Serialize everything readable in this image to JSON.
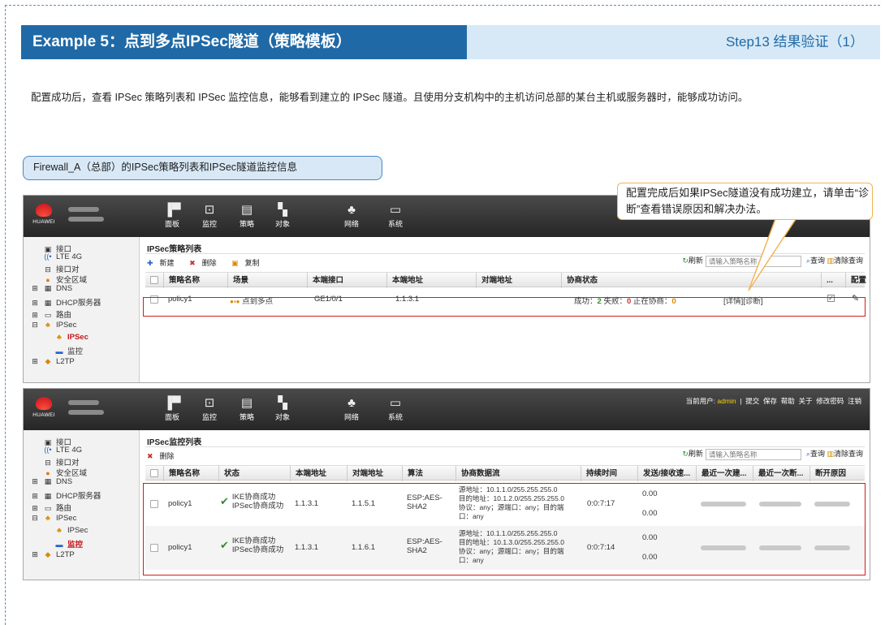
{
  "title": "Example 5：点到多点IPSec隧道（策略模板）",
  "step": "Step13 结果验证（1）",
  "description": "配置成功后，查看 IPSec 策略列表和 IPSec 监控信息，能够看到建立的 IPSec 隧道。且使用分支机构中的主机访问总部的某台主机或服务器时，能够成功访问。",
  "caption": "Firewall_A（总部）的IPSec策略列表和IPSec隧道监控信息",
  "callout": "配置完成后如果IPSec隧道没有成功建立，请单击“诊断”查看错误原因和解决办法。",
  "logo_text": "HUAWEI",
  "nav": [
    {
      "label": "面板",
      "icon": "dashboard-icon"
    },
    {
      "label": "监控",
      "icon": "monitor-icon"
    },
    {
      "label": "策略",
      "icon": "policy-icon"
    },
    {
      "label": "对象",
      "icon": "object-icon"
    },
    {
      "label": "网络",
      "icon": "network-icon"
    },
    {
      "label": "系统",
      "icon": "system-icon"
    }
  ],
  "userbar": {
    "prefix": "当前用户:",
    "user": "admin",
    "links": [
      "提交",
      "保存",
      "帮助",
      "关于",
      "修改密码",
      "注销"
    ]
  },
  "sidebar": {
    "items": [
      "接口",
      "LTE 4G",
      "接口对",
      "安全区域",
      "DNS",
      "DHCP服务器",
      "路由",
      "IPSec",
      "IPSec",
      "监控",
      "L2TP"
    ]
  },
  "screen1": {
    "title": "IPSec策略列表",
    "toolbar": {
      "new": "新建",
      "delete": "删除",
      "copy": "复制"
    },
    "refresh": "刷新",
    "search_placeholder": "请输入策略名称",
    "query": "查询",
    "clear": "清除查询",
    "columns": [
      "策略名称",
      "场景",
      "本端接口",
      "本端地址",
      "对端地址",
      "协商状态",
      "...",
      "配置"
    ],
    "row": {
      "name": "policy1",
      "scene": "点到多点",
      "iface": "GE1/0/1",
      "local": "1.1.3.1",
      "peer": "",
      "success_label": "成功：",
      "success": "2",
      "fail_label": "失败：",
      "fail": "0",
      "nego_label": "正在协商：",
      "nego": "0",
      "detail": "[详情]",
      "diag": "[诊断]"
    }
  },
  "screen2": {
    "title": "IPSec监控列表",
    "toolbar": {
      "delete": "删除"
    },
    "refresh": "刷新",
    "search_placeholder": "请输入策略名称",
    "query": "查询",
    "clear": "清除查询",
    "columns": [
      "策略名称",
      "状态",
      "本端地址",
      "对端地址",
      "算法",
      "协商数据流",
      "持续时间",
      "发送/接收速...",
      "最近一次建...",
      "最近一次断...",
      "断开原因"
    ],
    "rows": [
      {
        "name": "policy1",
        "status1": "IKE协商成功",
        "status2": "IPSec协商成功",
        "local": "1.1.3.1",
        "peer": "1.1.5.1",
        "algo1": "ESP:AES-",
        "algo2": "SHA2",
        "flow1": "源地址：10.1.1.0/255.255.255.0",
        "flow2": "目的地址：10.1.2.0/255.255.255.0",
        "flow3": "协议：any；源端口：any；目的端",
        "flow4": "口：any",
        "duration": "0:0:7:17",
        "send": "0.00",
        "recv": "0.00"
      },
      {
        "name": "policy1",
        "status1": "IKE协商成功",
        "status2": "IPSec协商成功",
        "local": "1.1.3.1",
        "peer": "1.1.6.1",
        "algo1": "ESP:AES-",
        "algo2": "SHA2",
        "flow1": "源地址：10.1.1.0/255.255.255.0",
        "flow2": "目的地址：10.1.3.0/255.255.255.0",
        "flow3": "协议：any；源端口：any；目的端",
        "flow4": "口：any",
        "duration": "0:0:7:14",
        "send": "0.00",
        "recv": "0.00"
      }
    ]
  }
}
